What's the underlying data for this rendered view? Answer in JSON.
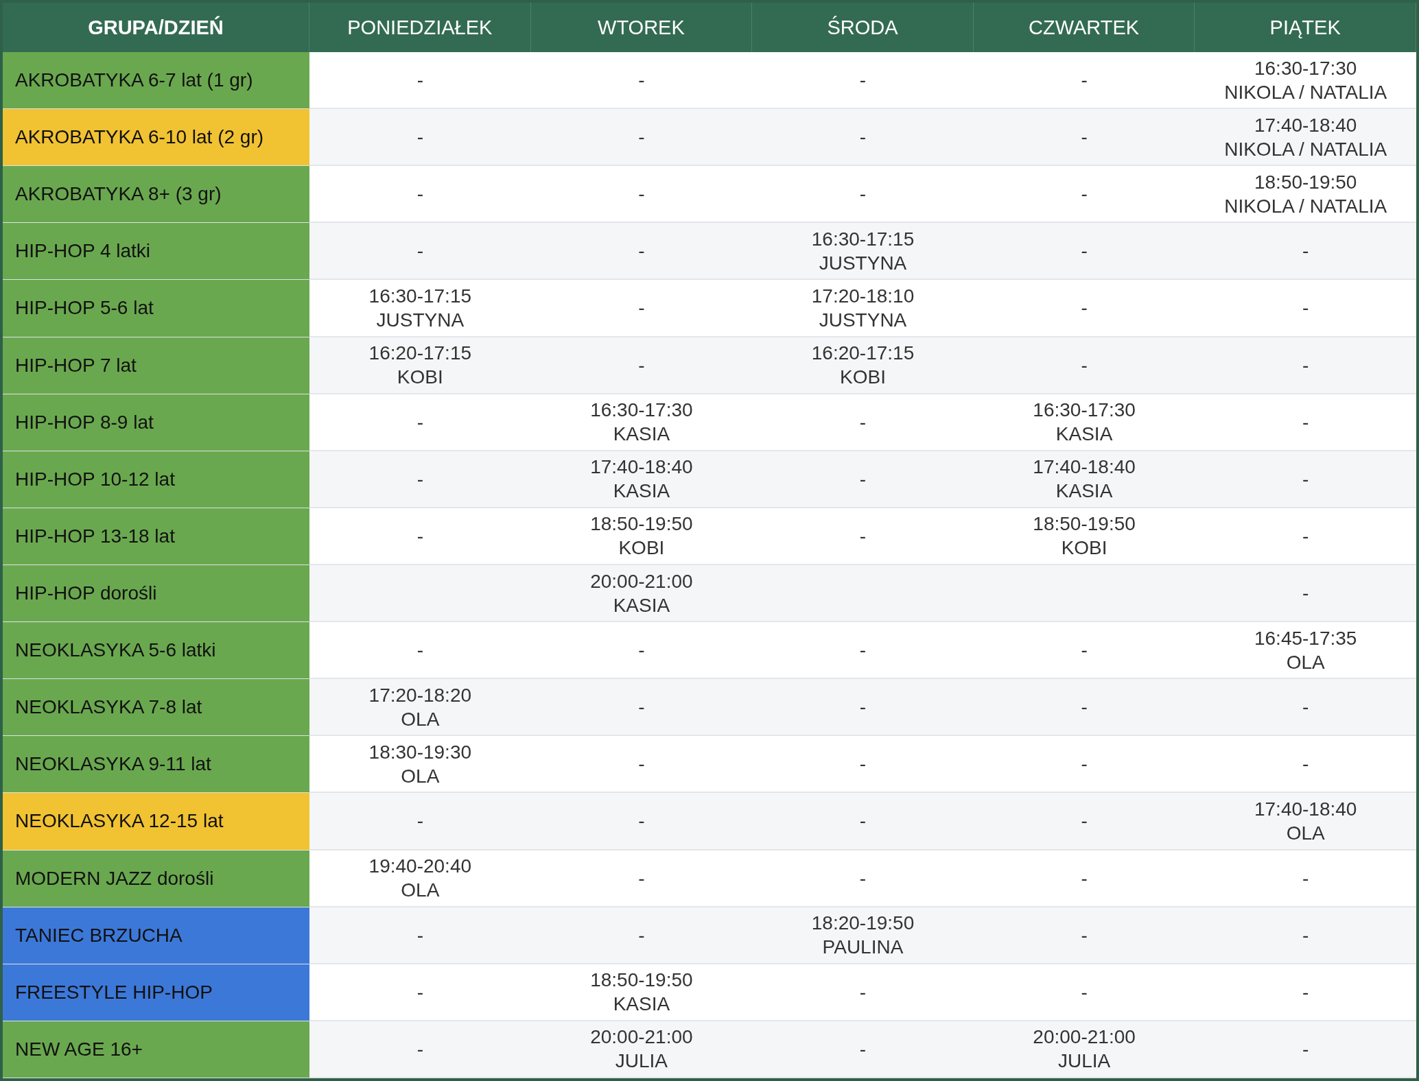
{
  "header": [
    "GRUPA/DZIEŃ",
    "PONIEDZIAŁEK",
    "WTOREK",
    "ŚRODA",
    "CZWARTEK",
    "PIĄTEK"
  ],
  "rows": [
    {
      "group": "AKROBATYKA 6-7 lat (1 gr)",
      "color": "#6aa84f",
      "cells": [
        {
          "text": "-"
        },
        {
          "text": "-"
        },
        {
          "text": "-"
        },
        {
          "text": "-"
        },
        {
          "time": "16:30-17:30",
          "teacher": "NIKOLA / NATALIA"
        }
      ]
    },
    {
      "group": "AKROBATYKA 6-10 lat (2 gr)",
      "color": "#f1c232",
      "cells": [
        {
          "text": "-"
        },
        {
          "text": "-"
        },
        {
          "text": "-"
        },
        {
          "text": "-"
        },
        {
          "time": "17:40-18:40",
          "teacher": "NIKOLA / NATALIA"
        }
      ]
    },
    {
      "group": "AKROBATYKA 8+ (3 gr)",
      "color": "#6aa84f",
      "cells": [
        {
          "text": "-"
        },
        {
          "text": "-"
        },
        {
          "text": "-"
        },
        {
          "text": "-"
        },
        {
          "time": "18:50-19:50",
          "teacher": "NIKOLA / NATALIA"
        }
      ]
    },
    {
      "group": "HIP-HOP 4 latki",
      "color": "#6aa84f",
      "cells": [
        {
          "text": "-"
        },
        {
          "text": "-"
        },
        {
          "time": "16:30-17:15",
          "teacher": "JUSTYNA"
        },
        {
          "text": "-"
        },
        {
          "text": "-"
        }
      ]
    },
    {
      "group": "HIP-HOP 5-6 lat",
      "color": "#6aa84f",
      "cells": [
        {
          "time": "16:30-17:15",
          "teacher": "JUSTYNA"
        },
        {
          "text": "-"
        },
        {
          "time": "17:20-18:10",
          "teacher": "JUSTYNA"
        },
        {
          "text": "-"
        },
        {
          "text": "-"
        }
      ]
    },
    {
      "group": "HIP-HOP 7 lat",
      "color": "#6aa84f",
      "cells": [
        {
          "time": "16:20-17:15",
          "teacher": "KOBI"
        },
        {
          "text": "-"
        },
        {
          "time": "16:20-17:15",
          "teacher": "KOBI"
        },
        {
          "text": "-"
        },
        {
          "text": "-"
        }
      ]
    },
    {
      "group": "HIP-HOP 8-9 lat",
      "color": "#6aa84f",
      "cells": [
        {
          "text": "-"
        },
        {
          "time": "16:30-17:30",
          "teacher": "KASIA"
        },
        {
          "text": "-"
        },
        {
          "time": "16:30-17:30",
          "teacher": "KASIA"
        },
        {
          "text": "-"
        }
      ]
    },
    {
      "group": "HIP-HOP 10-12 lat",
      "color": "#6aa84f",
      "cells": [
        {
          "text": "-"
        },
        {
          "time": "17:40-18:40",
          "teacher": "KASIA"
        },
        {
          "text": "-"
        },
        {
          "time": "17:40-18:40",
          "teacher": "KASIA"
        },
        {
          "text": "-"
        }
      ]
    },
    {
      "group": "HIP-HOP 13-18 lat",
      "color": "#6aa84f",
      "cells": [
        {
          "text": "-"
        },
        {
          "time": "18:50-19:50",
          "teacher": "KOBI"
        },
        {
          "text": "-"
        },
        {
          "time": "18:50-19:50",
          "teacher": "KOBI"
        },
        {
          "text": "-"
        }
      ]
    },
    {
      "group": "HIP-HOP dorośli",
      "color": "#6aa84f",
      "cells": [
        {},
        {
          "time": "20:00-21:00",
          "teacher": "KASIA"
        },
        {},
        {},
        {
          "text": "-"
        }
      ]
    },
    {
      "group": "NEOKLASYKA 5-6 latki",
      "color": "#6aa84f",
      "cells": [
        {
          "text": "-"
        },
        {
          "text": "-"
        },
        {
          "text": "-"
        },
        {
          "text": "-"
        },
        {
          "time": "16:45-17:35",
          "teacher": "OLA"
        }
      ]
    },
    {
      "group": "NEOKLASYKA 7-8 lat",
      "color": "#6aa84f",
      "cells": [
        {
          "time": "17:20-18:20",
          "teacher": "OLA"
        },
        {
          "text": "-"
        },
        {
          "text": "-"
        },
        {
          "text": "-"
        },
        {
          "text": "-"
        }
      ]
    },
    {
      "group": "NEOKLASYKA 9-11 lat",
      "color": "#6aa84f",
      "cells": [
        {
          "time": "18:30-19:30",
          "teacher": "OLA"
        },
        {
          "text": "-"
        },
        {
          "text": "-"
        },
        {
          "text": "-"
        },
        {
          "text": "-"
        }
      ]
    },
    {
      "group": "NEOKLASYKA 12-15 lat",
      "color": "#f1c232",
      "cells": [
        {
          "text": "-"
        },
        {
          "text": "-"
        },
        {
          "text": "-"
        },
        {
          "text": "-"
        },
        {
          "time": "17:40-18:40",
          "teacher": "OLA"
        }
      ]
    },
    {
      "group": "MODERN JAZZ dorośli",
      "color": "#6aa84f",
      "cells": [
        {
          "time": "19:40-20:40",
          "teacher": "OLA"
        },
        {
          "text": "-"
        },
        {
          "text": "-"
        },
        {
          "text": "-"
        },
        {
          "text": "-"
        }
      ]
    },
    {
      "group": "TANIEC BRZUCHA",
      "color": "#3c78d8",
      "cells": [
        {
          "text": "-"
        },
        {
          "text": "-"
        },
        {
          "time": "18:20-19:50",
          "teacher": "PAULINA"
        },
        {
          "text": "-"
        },
        {
          "text": "-"
        }
      ]
    },
    {
      "group": "FREESTYLE HIP-HOP",
      "color": "#3c78d8",
      "cells": [
        {
          "text": "-"
        },
        {
          "time": "18:50-19:50",
          "teacher": "KASIA"
        },
        {
          "text": "-"
        },
        {
          "text": "-"
        },
        {
          "text": "-"
        }
      ]
    },
    {
      "group": "NEW AGE 16+",
      "color": "#6aa84f",
      "cells": [
        {
          "text": "-"
        },
        {
          "time": "20:00-21:00",
          "teacher": "JULIA"
        },
        {
          "text": "-"
        },
        {
          "time": "20:00-21:00",
          "teacher": "JULIA"
        },
        {
          "text": "-"
        }
      ]
    }
  ]
}
